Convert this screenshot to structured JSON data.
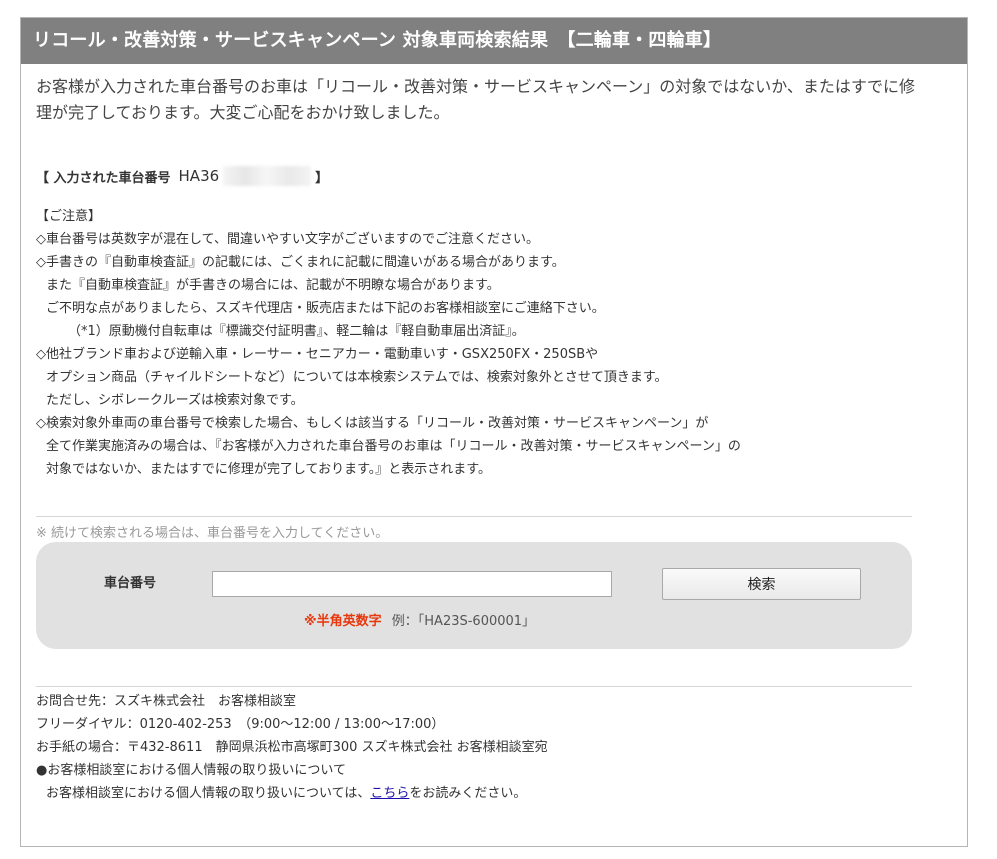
{
  "header": {
    "title": "リコール・改善対策・サービスキャンペーン 対象車両検索結果　【二輪車・四輪車】"
  },
  "intro": {
    "text": "お客様が入力された車台番号のお車は「リコール・改善対策・サービスキャンペーン」の対象ではないか、またはすでに修理が完了しております。大変ご心配をおかけ致しました。"
  },
  "entered": {
    "open": "【 入力された車台番号",
    "value": "HA36",
    "close": "】"
  },
  "notes": {
    "heading": "【ご注意】",
    "lines": [
      "◇車台番号は英数字が混在して、間違いやすい文字がございますのでご注意ください。",
      "◇手書きの『自動車検査証』の記載には、ごくまれに記載に間違いがある場合があります。",
      "また『自動車検査証』が手書きの場合には、記載が不明瞭な場合があります。",
      "ご不明な点がありましたら、スズキ代理店・販売店または下記のお客様相談室にご連絡下さい。",
      "（*1）原動機付自転車は『標識交付証明書』、軽二輪は『軽自動車届出済証』。",
      "◇他社ブランド車および逆輸入車・レーサー・セニアカー・電動車いす・GSX250FX・250SBや",
      "オプション商品（チャイルドシートなど）については本検索システムでは、検索対象外とさせて頂きます。",
      "ただし、シボレークルーズは検索対象です。",
      "◇検索対象外車両の車台番号で検索した場合、もしくは該当する「リコール・改善対策・サービスキャンペーン」が",
      "全て作業実施済みの場合は、『お客様が入力された車台番号のお車は「リコール・改善対策・サービスキャンペーン」の",
      "対象ではないか、またはすでに修理が完了しております。』と表示されます。"
    ]
  },
  "search": {
    "hint": "※ 続けて検索される場合は、車台番号を入力してください。",
    "label": "車台番号",
    "input_value": "",
    "button_label": "検索",
    "format_warning": "※半角英数字",
    "example": "例：「HA23S-600001」"
  },
  "footer": {
    "contact": "お問合せ先：スズキ株式会社　お客様相談室",
    "freedial": "フリーダイヤル：0120-402-253　（9:00～12:00 / 13:00～17:00）",
    "mail": "お手紙の場合：〒432-8611　静岡県浜松市高塚町300 スズキ株式会社 お客様相談室宛",
    "privacy_heading": "●お客様相談室における個人情報の取り扱いについて",
    "privacy_prefix": "お客様相談室における個人情報の取り扱いについては、",
    "privacy_link": "こちら",
    "privacy_suffix": "をお読みください。"
  },
  "colors": {
    "header_bg": "#808080",
    "search_panel_bg": "#e1e1e1",
    "warning": "#e8380d",
    "link": "#1a0dab"
  }
}
